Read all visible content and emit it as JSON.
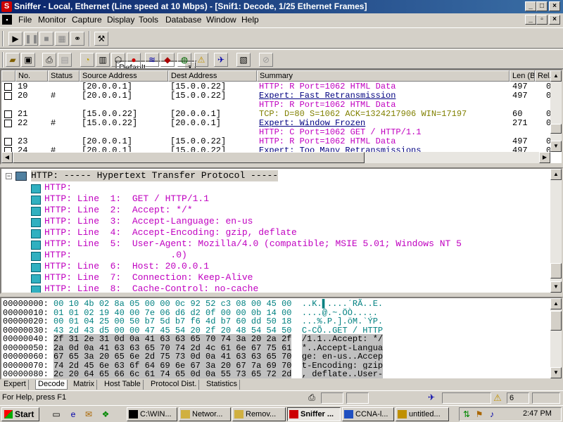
{
  "window": {
    "title": "Sniffer - Local, Ethernet (Line speed at 10 Mbps) - [Snif1: Decode, 1/25 Ethernet Frames]",
    "app_letter": "S"
  },
  "menu": [
    "File",
    "Monitor",
    "Capture",
    "Display",
    "Tools",
    "Database",
    "Window",
    "Help"
  ],
  "toolbar": {
    "profile": "Default"
  },
  "summary": {
    "columns": [
      "No.",
      "Status",
      "Source Address",
      "Dest Address",
      "Summary",
      "Len (B",
      "Rel."
    ],
    "rows": [
      {
        "no": "19",
        "status": "",
        "src": "[20.0.0.1]",
        "dst": "[15.0.0.22]",
        "len": "497",
        "rel": "0"
      },
      {
        "no": "20",
        "status": "#",
        "src": "[20.0.0.1]",
        "dst": "[15.0.0.22]",
        "len": "497",
        "rel": "0"
      },
      {
        "no": "21",
        "status": "",
        "src": "[15.0.0.22]",
        "dst": "[20.0.0.1]",
        "len": "60",
        "rel": "0"
      },
      {
        "no": "22",
        "status": "#",
        "src": "[15.0.0.22]",
        "dst": "[20.0.0.1]",
        "len": "271",
        "rel": "0"
      },
      {
        "no": "23",
        "status": "",
        "src": "[20.0.0.1]",
        "dst": "[15.0.0.22]",
        "len": "497",
        "rel": "0"
      },
      {
        "no": "24",
        "status": "#",
        "src": "[20.0.0.1]",
        "dst": "[15.0.0.22]",
        "len": "497",
        "rel": "0"
      }
    ],
    "lines": [
      {
        "text": "HTTP: R Port=1062 HTML Data",
        "color": "#c000c0"
      },
      {
        "text": "Expert: Fast Retransmission",
        "color": "#000080"
      },
      {
        "text": "HTTP: R Port=1062 HTML Data",
        "color": "#c000c0"
      },
      {
        "text": "TCP: D=80 S=1062     ACK=1324217906 WIN=17197",
        "color": "#808000"
      },
      {
        "text": "Expert: Window Frozen",
        "color": "#000080"
      },
      {
        "text": "HTTP: C Port=1062 GET / HTTP/1.1",
        "color": "#c000c0"
      },
      {
        "text": "HTTP: R Port=1062 HTML Data",
        "color": "#c000c0"
      },
      {
        "text": "Expert: Too Many Retransmissions",
        "color": "#000080"
      }
    ]
  },
  "decode": {
    "header": "HTTP: ----- Hypertext Transfer Protocol -----",
    "lines": [
      "HTTP:",
      "HTTP: Line  1:  GET / HTTP/1.1",
      "HTTP: Line  2:  Accept: */*",
      "HTTP: Line  3:  Accept-Language: en-us",
      "HTTP: Line  4:  Accept-Encoding: gzip, deflate",
      "HTTP: Line  5:  User-Agent: Mozilla/4.0 (compatible; MSIE 5.01; Windows NT 5",
      "HTTP:                  .0)",
      "HTTP: Line  6:  Host: 20.0.0.1",
      "HTTP: Line  7:  Connection: Keep-Alive",
      "HTTP: Line  8:  Cache-Control: no-cache"
    ]
  },
  "hex": {
    "rows": [
      {
        "off": "00000000:",
        "bytes": "00 10 4b 02 8a 05 00 00 0c 92 52 c3 08 00 45 00",
        "ascii": "..K.▌....´RÃ..E."
      },
      {
        "off": "00000010:",
        "bytes": "01 01 02 19 40 00 7e 06 d6 d2 0f 00 00 0b 14 00",
        "ascii": "....@.~.ÖÒ....."
      },
      {
        "off": "00000020:",
        "bytes": "00 01 04 25 00 50 b7 5d b7 f6 4d b7 60 dd 50 18",
        "ascii": "...%.P.].öM.`ÝP."
      },
      {
        "off": "00000030:",
        "bytes": "43 2d 43 d5 00 00 47 45 54 20 2f 20 48 54 54 50",
        "ascii": "C-CÕ..GET / HTTP"
      },
      {
        "off": "00000040:",
        "bytes": "2f 31 2e 31 0d 0a 41 63 63 65 70 74 3a 20 2a 2f",
        "ascii": "/1.1..Accept: */"
      },
      {
        "off": "00000050:",
        "bytes": "2a 0d 0a 41 63 63 65 70 74 2d 4c 61 6e 67 75 61",
        "ascii": "*..Accept-Langua"
      },
      {
        "off": "00000060:",
        "bytes": "67 65 3a 20 65 6e 2d 75 73 0d 0a 41 63 63 65 70",
        "ascii": "ge: en-us..Accep"
      },
      {
        "off": "00000070:",
        "bytes": "74 2d 45 6e 63 6f 64 69 6e 67 3a 20 67 7a 69 70",
        "ascii": "t-Encoding: gzip"
      },
      {
        "off": "00000080:",
        "bytes": "2c 20 64 65 66 6c 61 74 65 0d 0a 55 73 65 72 2d",
        "ascii": ", deflate..User-"
      }
    ]
  },
  "tabs": [
    "Expert",
    "Decode",
    "Matrix",
    "Host Table",
    "Protocol Dist.",
    "Statistics"
  ],
  "status": {
    "help": "For Help, press F1",
    "count": "6"
  },
  "taskbar": {
    "start": "Start",
    "tasks": [
      "C:\\WIN...",
      "Networ...",
      "Remov...",
      "Sniffer ...",
      "CCNA-l...",
      "untitled..."
    ],
    "clock": "2:47 PM"
  },
  "colors": {
    "titlebar": "#0a246a",
    "http": "#c000c0",
    "expert": "#000080",
    "tcp": "#808000",
    "hex": "#008080"
  }
}
